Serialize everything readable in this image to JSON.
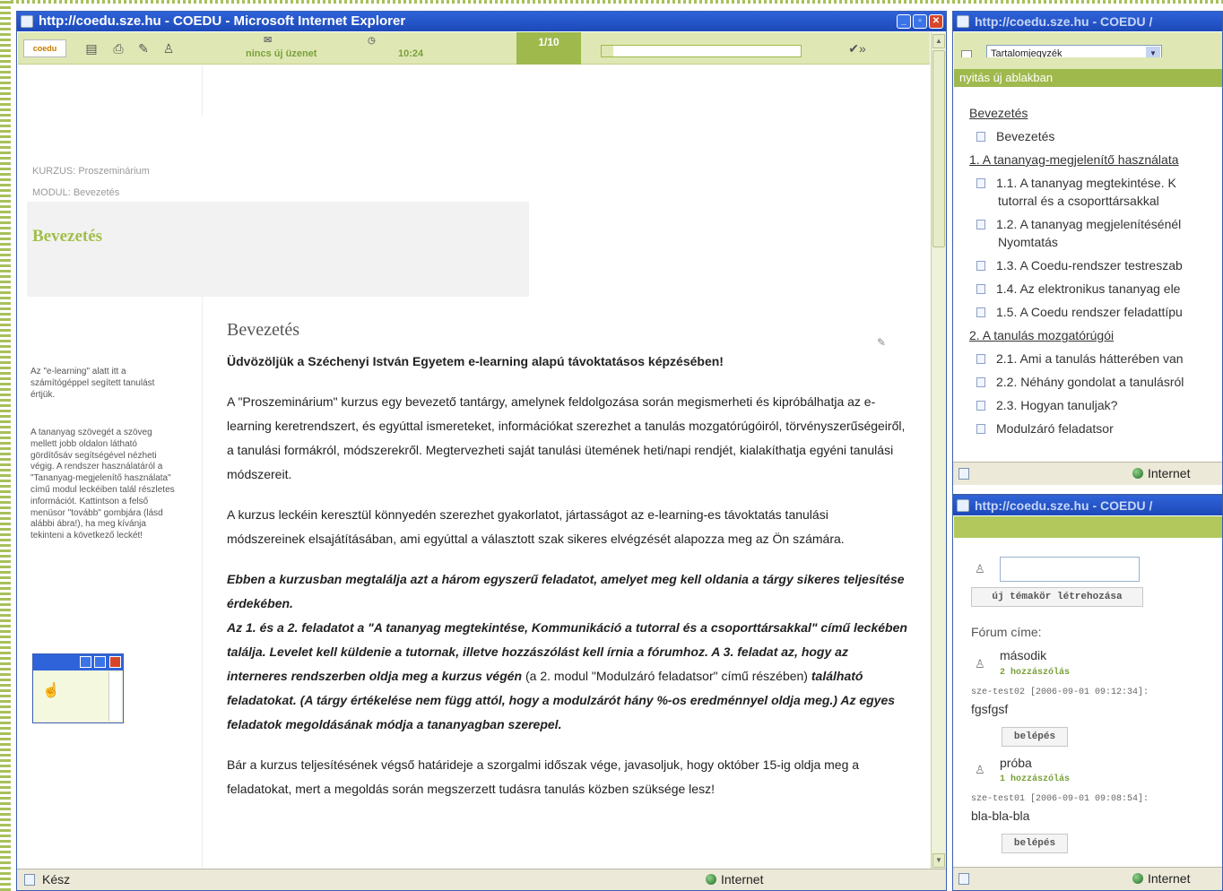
{
  "main_window": {
    "title": "http://coedu.sze.hu - COEDU - Microsoft Internet Explorer",
    "status_left": "Kész",
    "status_zone": "Internet"
  },
  "toolbar": {
    "logo": "coedu",
    "message": "nincs új üzenet",
    "time": "10:24",
    "page_counter": "1/10",
    "progress": 0.06
  },
  "course": {
    "kurzus": "KURZUS: Proszeminárium",
    "modul": "MODUL: Bevezetés",
    "section_title": "Bevezetés"
  },
  "sidenote": {
    "p1": "Az \"e-learning\" alatt itt a számítógéppel segített tanulást értjük.",
    "p2": "A tananyag szövegét a szöveg mellett jobb oldalon látható gördítősáv segítségével nézheti végig. A rendszer használatáról a \"Tananyag-megjelenítő használata\" című modul leckéiben talál részletes információt. Kattintson a felső menüsor \"tovább\" gombjára (lásd alábbi ábra!), ha meg kívánja tekinteni a következő leckét!"
  },
  "article": {
    "heading": "Bevezetés",
    "welcome": "Üdvözöljük a Széchenyi István Egyetem e-learning alapú távoktatásos képzésében!",
    "p1": "A \"Proszeminárium\" kurzus egy bevezető tantárgy, amelynek feldolgozása során megismerheti és kipróbálhatja az e-learning keretrendszert, és egyúttal ismereteket, információkat szerezhet a tanulás mozgatórúgóiról, törvényszerűségeiről, a tanulási formákról, módszerekről. Megtervezheti saját tanulási ütemének heti/napi rendjét, kialakíthatja egyéni tanulási módszereit.",
    "p2": "A kurzus leckéin keresztül könnyedén szerezhet gyakorlatot, jártasságot az e-learning-es távoktatás tanulási módszereinek elsajátításában, ami egyúttal a választott szak sikeres elvégzését alapozza meg az Ön számára.",
    "p3_bold_a": "Ebben a kurzusban megtalálja azt a három egyszerű feladatot, amelyet meg kell oldania a tárgy sikeres teljesítése érdekében.",
    "p3_bold_b": "Az 1. és a 2. feladatot a \"A tananyag megtekintése, Kommunikáció a tutorral és a csoporttársakkal\" című leckében találja. Levelet kell küldenie a tutornak, illetve hozzászólást kell írnia a fórumhoz. A 3. feladat az, hogy az interneres rendszerben oldja meg a kurzus végén",
    "p3_normal": "(a 2. modul \"Modulzáró feladatsor\" című részében)",
    "p3_bold_c": "található feladatokat. (A tárgy értékelése nem függ attól, hogy a modulzárót hány %-os eredménnyel oldja meg.) Az egyes feladatok megoldásának módja a tananyagban szerepel.",
    "p4": "Bár a kurzus teljesítésének végső határideje a szorgalmi időszak vége, javasoljuk, hogy október 15-ig oldja meg a feladatokat, mert a megoldás során megszerzett tudásra tanulás közben szüksége lesz!"
  },
  "toc_window": {
    "title": "http://coedu.sze.hu - COEDU /",
    "select_value": "Tartalomjegyzék",
    "open_new": "nyitás új ablakban",
    "items": [
      {
        "type": "head",
        "label": "Bevezetés"
      },
      {
        "type": "item",
        "label": "Bevezetés"
      },
      {
        "type": "head",
        "label": "1. A tananyag-megjelenítő használata"
      },
      {
        "type": "item",
        "label": "1.1. A tananyag megtekintése. K"
      },
      {
        "type": "cont",
        "label": "tutorral és a csoporttársakkal"
      },
      {
        "type": "item",
        "label": "1.2. A tananyag megjelenítésénél"
      },
      {
        "type": "cont",
        "label": "Nyomtatás"
      },
      {
        "type": "item",
        "label": "1.3. A Coedu-rendszer testreszab"
      },
      {
        "type": "item",
        "label": "1.4. Az elektronikus tananyag ele"
      },
      {
        "type": "item",
        "label": "1.5. A Coedu rendszer feladattípu"
      },
      {
        "type": "head",
        "label": "2. A tanulás mozgatórúgói"
      },
      {
        "type": "item",
        "label": "2.1. Ami a tanulás hátterében van"
      },
      {
        "type": "item",
        "label": "2.2. Néhány gondolat a tanulásról"
      },
      {
        "type": "item",
        "label": "2.3. Hogyan tanuljak?"
      },
      {
        "type": "item",
        "label": "Modulzáró feladatsor"
      }
    ],
    "status_zone": "Internet"
  },
  "forum_window": {
    "title": "http://coedu.sze.hu - COEDU /",
    "new_topic": "új témakör létrehozása",
    "forum_label": "Fórum címe:",
    "topics": [
      {
        "name": "második",
        "count": "2 hozzászólás",
        "meta": "sze-test02 [2006-09-01 09:12:34]:",
        "text": "fgsfgsf",
        "enter": "belépés"
      },
      {
        "name": "próba",
        "count": "1 hozzászólás",
        "meta": "sze-test01 [2006-09-01 09:08:54]:",
        "text": "bla-bla-bla",
        "enter": "belépés"
      }
    ],
    "status_zone": "Internet"
  }
}
